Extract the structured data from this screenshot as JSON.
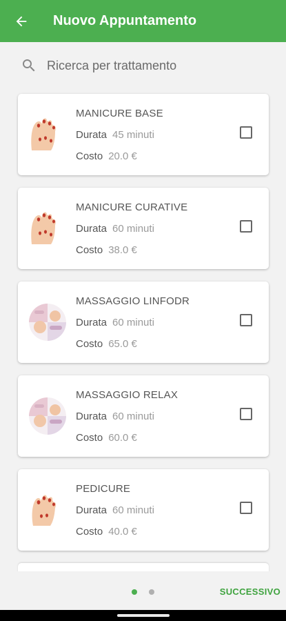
{
  "header": {
    "title": "Nuovo Appuntamento"
  },
  "search": {
    "placeholder": "Ricerca per trattamento",
    "value": ""
  },
  "labels": {
    "duration": "Durata",
    "cost": "Costo"
  },
  "treatments": [
    {
      "name": "MANICURE BASE",
      "duration": "45 minuti",
      "cost": "20.0 €",
      "image": "manicure-image",
      "checked": false
    },
    {
      "name": "MANICURE CURATIVE",
      "duration": "60 minuti",
      "cost": "38.0 €",
      "image": "manicure-image",
      "checked": false
    },
    {
      "name": "MASSAGGIO LINFODR",
      "duration": "60 minuti",
      "cost": "65.0 €",
      "image": "massage-image",
      "checked": false
    },
    {
      "name": "MASSAGGIO RELAX",
      "duration": "60 minuti",
      "cost": "60.0 €",
      "image": "massage-image",
      "checked": false
    },
    {
      "name": "PEDICURE",
      "duration": "60 minuti",
      "cost": "40.0 €",
      "image": "pedicure-image",
      "checked": false
    }
  ],
  "pager": {
    "current_page": 1,
    "total_pages": 2
  },
  "footer": {
    "next_label": "SUCCESSIVO"
  },
  "colors": {
    "primary": "#4caf50",
    "accent_text": "#3fa33f",
    "background": "#f2f2f2"
  }
}
